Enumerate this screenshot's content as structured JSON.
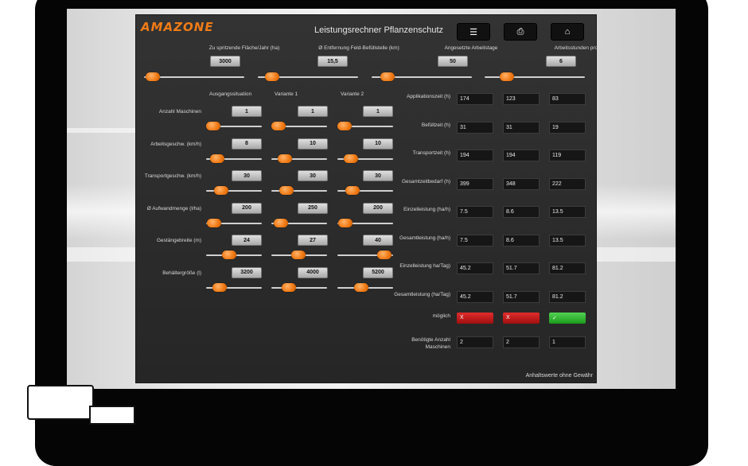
{
  "header": {
    "logo": "AMAZONE",
    "title": "Leistungsrechner Pflanzenschutz",
    "menu_icon": "menu-icon",
    "print_icon": "print-icon",
    "home_icon": "home-icon"
  },
  "top_params": [
    {
      "label": "Zu spritzende Fläche/Jahr (ha)",
      "value": "3000",
      "level": 0.02
    },
    {
      "label": "Ø Entfernung Feld-Befüllstelle (km)",
      "value": "15,5",
      "level": 0.08
    },
    {
      "label": "Angesetzte Arbeitstage",
      "value": "50",
      "level": 0.1
    },
    {
      "label": "Arbeitsstunden pro Tag",
      "value": "6",
      "level": 0.18
    }
  ],
  "columns": [
    "Ausgangssituation",
    "Variante 1",
    "Variante 2"
  ],
  "params": [
    {
      "label": "Anzahl Maschinen",
      "values": [
        "1",
        "1",
        "1"
      ],
      "levels": [
        0.0,
        0.0,
        0.0
      ]
    },
    {
      "label": "Arbeitsgeschw. (km/h)",
      "values": [
        "8",
        "10",
        "10"
      ],
      "levels": [
        0.1,
        0.15,
        0.15
      ]
    },
    {
      "label": "Transportgeschw. (km/h)",
      "values": [
        "30",
        "30",
        "30"
      ],
      "levels": [
        0.2,
        0.2,
        0.2
      ]
    },
    {
      "label": "Ø Aufwandmenge (l/ha)",
      "values": [
        "200",
        "250",
        "200"
      ],
      "levels": [
        0.02,
        0.05,
        0.02
      ]
    },
    {
      "label": "Gestängebreite (m)",
      "values": [
        "24",
        "27",
        "40"
      ],
      "levels": [
        0.38,
        0.48,
        0.97
      ]
    },
    {
      "label": "Behältergröße (l)",
      "values": [
        "3200",
        "4000",
        "5200"
      ],
      "levels": [
        0.15,
        0.25,
        0.4
      ]
    }
  ],
  "results": [
    {
      "label": "Applikationszeit (h)",
      "values": [
        "174",
        "123",
        "83"
      ]
    },
    {
      "label": "Befüllzeit (h)",
      "values": [
        "31",
        "31",
        "19"
      ]
    },
    {
      "label": "Transportzeit (h)",
      "values": [
        "194",
        "194",
        "119"
      ]
    },
    {
      "label": "Gesamtzeitbedarf (h)",
      "values": [
        "399",
        "348",
        "222"
      ]
    },
    {
      "label": "Einzelleistung (ha/h)",
      "values": [
        "7.5",
        "8.6",
        "13.5"
      ]
    },
    {
      "label": "Gesamtleistung (ha/h)",
      "values": [
        "7.5",
        "8.6",
        "13.5"
      ]
    },
    {
      "label": "Einzelleistung ha/Tag)",
      "values": [
        "45.2",
        "51.7",
        "81.2"
      ]
    },
    {
      "label": "Gesamtleistung (ha/Tag)",
      "values": [
        "45.2",
        "51.7",
        "81.2"
      ]
    }
  ],
  "possible": {
    "label": "möglich",
    "values": [
      "X",
      "X",
      "✓"
    ],
    "status": [
      "no",
      "no",
      "yes"
    ]
  },
  "machines": {
    "label": "Benötigte Anzahl Maschinen",
    "values": [
      "2",
      "2",
      "1"
    ]
  },
  "footer": "Anhaltswerte ohne Gewähr",
  "colors": {
    "accent": "#f07b16",
    "panel": "#2b2b2b",
    "ok": "#2fb02f",
    "fail": "#c81e1e"
  }
}
